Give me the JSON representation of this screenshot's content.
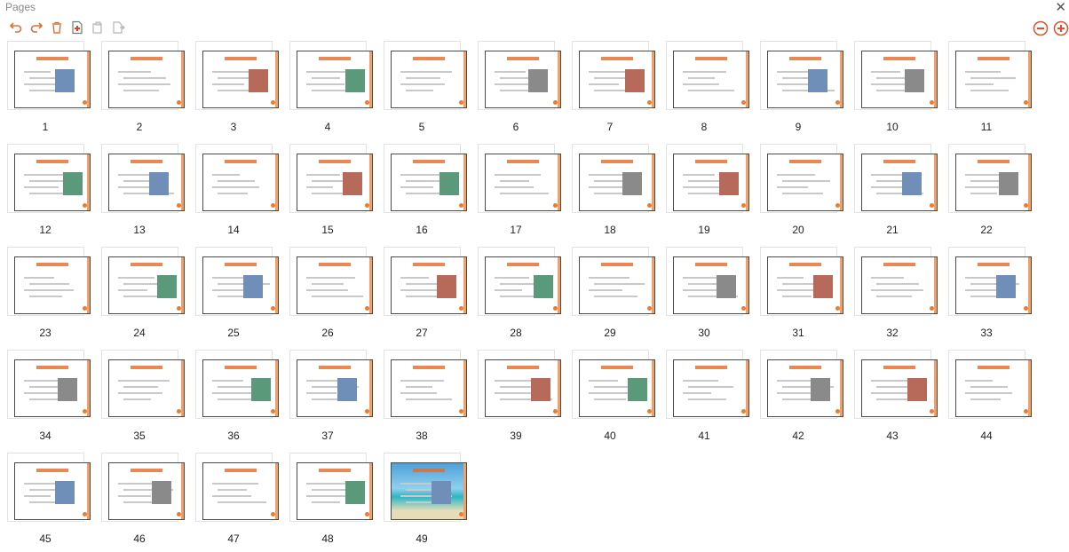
{
  "window": {
    "title": "Pages"
  },
  "toolbar": {
    "buttons": [
      {
        "name": "undo-button",
        "icon": "undo-icon"
      },
      {
        "name": "redo-button",
        "icon": "redo-icon"
      },
      {
        "name": "delete-button",
        "icon": "trash-icon"
      },
      {
        "name": "insert-page-button",
        "icon": "new-page-icon"
      },
      {
        "name": "copy-page-button",
        "icon": "copy-icon"
      },
      {
        "name": "paste-page-button",
        "icon": "paste-icon"
      }
    ]
  },
  "zoom": {
    "out_icon": "zoom-out-icon",
    "in_icon": "zoom-in-icon"
  },
  "accent": "#e56a28",
  "pages": [
    {
      "n": "1"
    },
    {
      "n": "2"
    },
    {
      "n": "3"
    },
    {
      "n": "4"
    },
    {
      "n": "5"
    },
    {
      "n": "6"
    },
    {
      "n": "7"
    },
    {
      "n": "8"
    },
    {
      "n": "9"
    },
    {
      "n": "10"
    },
    {
      "n": "11"
    },
    {
      "n": "12"
    },
    {
      "n": "13"
    },
    {
      "n": "14"
    },
    {
      "n": "15"
    },
    {
      "n": "16"
    },
    {
      "n": "17"
    },
    {
      "n": "18"
    },
    {
      "n": "19"
    },
    {
      "n": "20"
    },
    {
      "n": "21"
    },
    {
      "n": "22"
    },
    {
      "n": "23"
    },
    {
      "n": "24"
    },
    {
      "n": "25"
    },
    {
      "n": "26"
    },
    {
      "n": "27"
    },
    {
      "n": "28"
    },
    {
      "n": "29"
    },
    {
      "n": "30"
    },
    {
      "n": "31"
    },
    {
      "n": "32"
    },
    {
      "n": "33"
    },
    {
      "n": "34"
    },
    {
      "n": "35"
    },
    {
      "n": "36"
    },
    {
      "n": "37"
    },
    {
      "n": "38"
    },
    {
      "n": "39"
    },
    {
      "n": "40"
    },
    {
      "n": "41"
    },
    {
      "n": "42"
    },
    {
      "n": "43"
    },
    {
      "n": "44"
    },
    {
      "n": "45"
    },
    {
      "n": "46"
    },
    {
      "n": "47"
    },
    {
      "n": "48"
    },
    {
      "n": "49"
    }
  ]
}
